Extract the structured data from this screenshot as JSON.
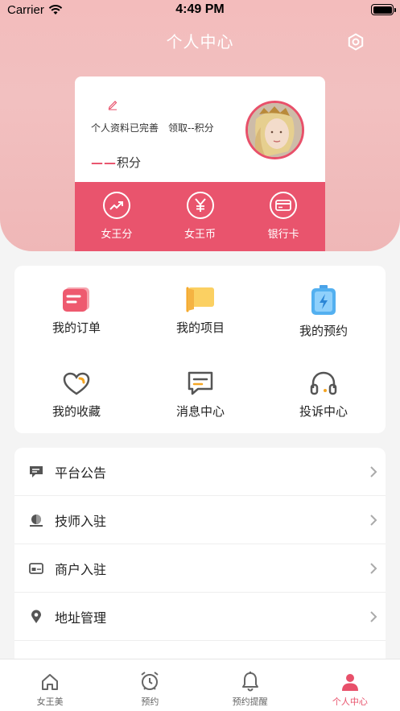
{
  "status_bar": {
    "carrier": "Carrier",
    "time": "4:49 PM"
  },
  "nav": {
    "title": "个人中心"
  },
  "profile": {
    "status_text": "个人资料已完善",
    "claim_text": "领取--积分",
    "points_value": "——",
    "points_unit": "积分"
  },
  "card_actions": [
    {
      "label": "女王分",
      "icon": "trend-up-icon"
    },
    {
      "label": "女王币",
      "icon": "yen-icon"
    },
    {
      "label": "银行卡",
      "icon": "bank-card-icon"
    }
  ],
  "grid": [
    {
      "label": "我的订单",
      "icon": "order-icon"
    },
    {
      "label": "我的项目",
      "icon": "project-flag-icon"
    },
    {
      "label": "我的预约",
      "icon": "battery-appointment-icon"
    },
    {
      "label": "我的收藏",
      "icon": "heart-icon"
    },
    {
      "label": "消息中心",
      "icon": "message-icon"
    },
    {
      "label": "投诉中心",
      "icon": "headphones-icon"
    }
  ],
  "list": [
    {
      "label": "平台公告",
      "icon": "announcement-icon"
    },
    {
      "label": "技师入驻",
      "icon": "technician-icon"
    },
    {
      "label": "商户入驻",
      "icon": "merchant-card-icon"
    },
    {
      "label": "地址管理",
      "icon": "location-pin-icon"
    }
  ],
  "tabs": [
    {
      "label": "女王美",
      "icon": "home-icon",
      "active": false
    },
    {
      "label": "预约",
      "icon": "alarm-clock-icon",
      "active": false
    },
    {
      "label": "预约提醒",
      "icon": "bell-icon",
      "active": false
    },
    {
      "label": "个人中心",
      "icon": "person-icon",
      "active": true
    }
  ],
  "colors": {
    "accent": "#e8506a",
    "header": "#f2bfbf",
    "background": "#f4f4f4"
  }
}
